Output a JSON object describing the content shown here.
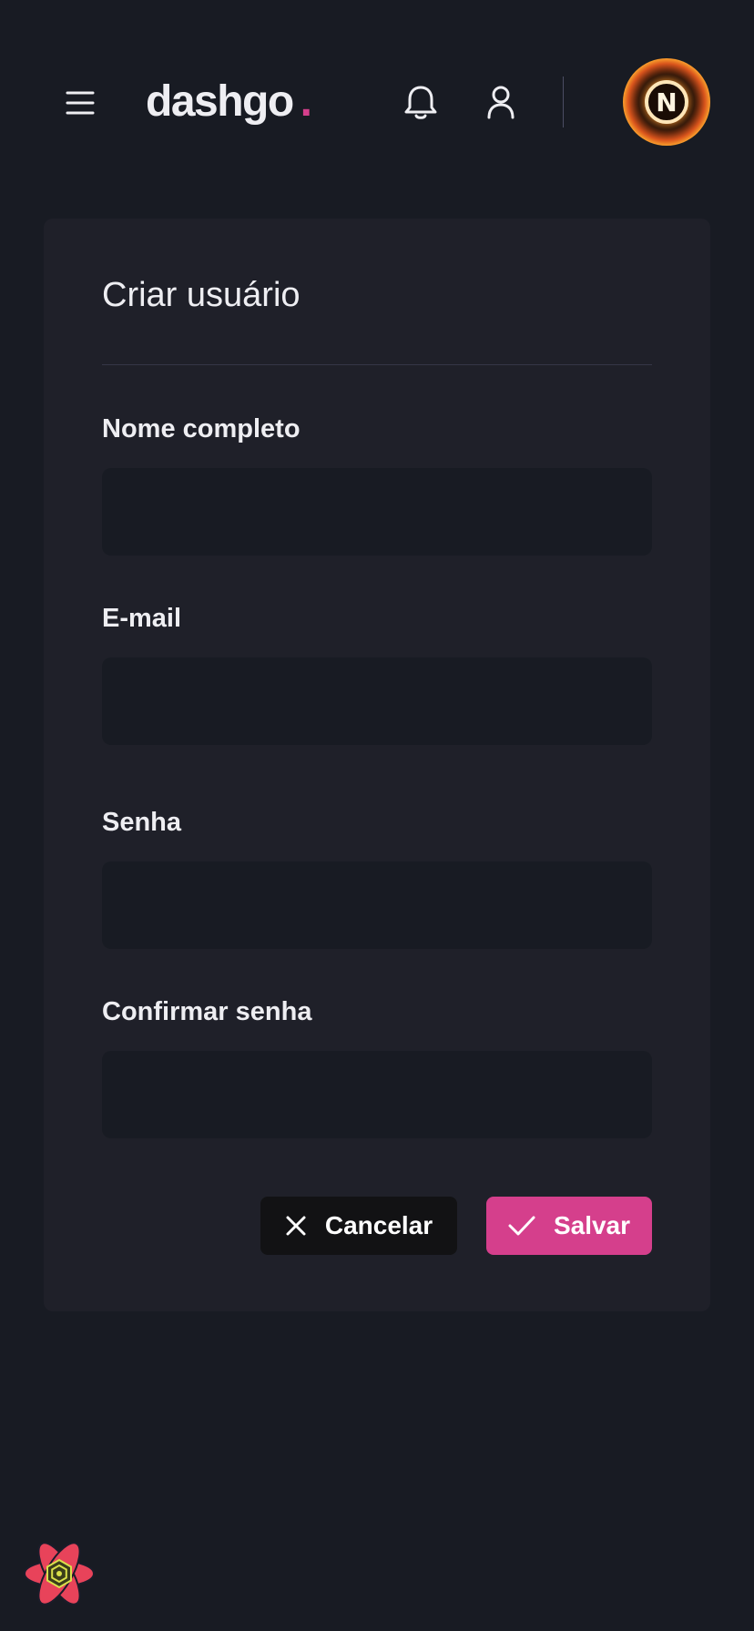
{
  "header": {
    "logo_text": "dashgo",
    "logo_dot": ".",
    "avatar_letter": "N"
  },
  "form": {
    "title": "Criar usuário",
    "fields": [
      {
        "label": "Nome completo",
        "value": ""
      },
      {
        "label": "E-mail",
        "value": ""
      },
      {
        "label": "Senha",
        "value": ""
      },
      {
        "label": "Confirmar senha",
        "value": ""
      }
    ],
    "cancel_label": "Cancelar",
    "save_label": "Salvar"
  },
  "colors": {
    "background": "#181b23",
    "card": "#1f2029",
    "accent": "#d53f8c",
    "cancel_button": "#121214"
  },
  "icons": [
    "menu-icon",
    "bell-icon",
    "user-icon",
    "close-icon",
    "check-icon",
    "react-logo-icon"
  ]
}
